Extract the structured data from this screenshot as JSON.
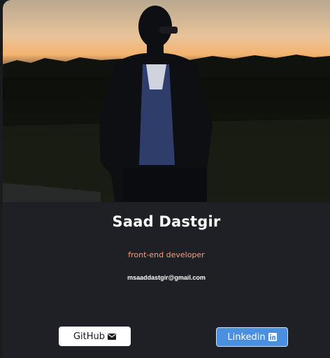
{
  "profile": {
    "name": "Saad Dastgir",
    "role": "front-end developer",
    "email": "msaaddastgir@gmail.com"
  },
  "links": {
    "github_label": "GitHub",
    "github_icon": "envelope-icon",
    "linkedin_label": "Linkedin",
    "linkedin_icon": "linkedin-icon"
  },
  "colors": {
    "card_background": "#1f2026",
    "role_text": "#f0a27a",
    "linkedin_button": "#4a8fe0",
    "github_button": "#ffffff"
  }
}
